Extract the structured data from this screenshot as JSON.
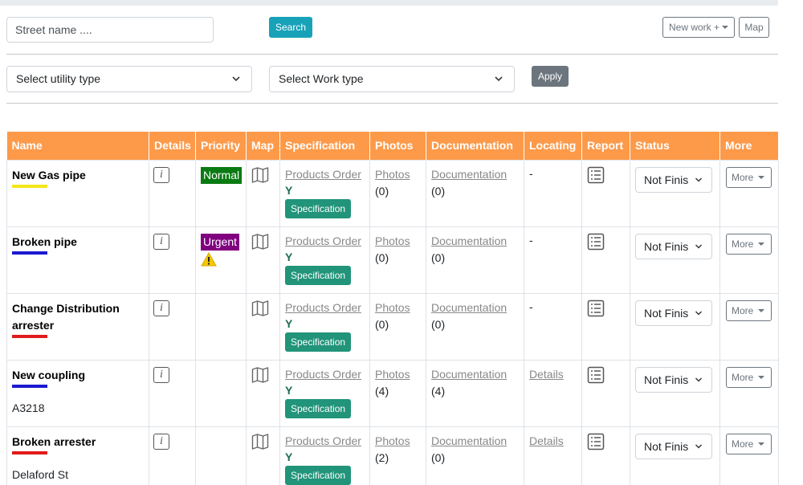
{
  "search": {
    "placeholder": "Street name ....",
    "button": "Search"
  },
  "header_actions": {
    "new_work": "New work +",
    "map": "Map"
  },
  "filters": {
    "utility_type": "Select utility type",
    "work_type": "Select Work type",
    "apply": "Apply"
  },
  "table": {
    "columns": [
      "Name",
      "Details",
      "Priority",
      "Map",
      "Specification",
      "Photos",
      "Documentation",
      "Locating",
      "Report",
      "Status",
      "More"
    ],
    "rows": [
      {
        "name": "New Gas pipe",
        "name_color": "#f5e61a",
        "subtitle": "",
        "priority": "Normal",
        "priority_color": "#0a7a12",
        "priority_warning": false,
        "spec_link": "Products Order",
        "spec_flag": "Y",
        "spec_button": "Specification",
        "photos_link": "Photos",
        "photos_count": "(0)",
        "docs_link": "Documentation",
        "docs_count": "(0)",
        "locating": "-",
        "locating_is_link": false,
        "status": "Not Finis",
        "more": "More"
      },
      {
        "name": "Broken pipe",
        "name_color": "#1a1ad0",
        "subtitle": "",
        "priority": "Urgent",
        "priority_color": "#800080",
        "priority_warning": true,
        "spec_link": "Products Order",
        "spec_flag": "Y",
        "spec_button": "Specification",
        "photos_link": "Photos",
        "photos_count": "(0)",
        "docs_link": "Documentation",
        "docs_count": "(0)",
        "locating": "-",
        "locating_is_link": false,
        "status": "Not Finis",
        "more": "More"
      },
      {
        "name": "Change Distribution arrester",
        "name_color": "#e01b1b",
        "subtitle": "",
        "priority": "",
        "priority_color": "",
        "priority_warning": false,
        "spec_link": "Products Order",
        "spec_flag": "Y",
        "spec_button": "Specification",
        "photos_link": "Photos",
        "photos_count": "(0)",
        "docs_link": "Documentation",
        "docs_count": "(0)",
        "locating": "-",
        "locating_is_link": false,
        "status": "Not Finis",
        "more": "More"
      },
      {
        "name": "New coupling",
        "name_color": "#1a1ad0",
        "subtitle": "A3218",
        "priority": "",
        "priority_color": "",
        "priority_warning": false,
        "spec_link": "Products Order",
        "spec_flag": "Y",
        "spec_button": "Specification",
        "photos_link": "Photos",
        "photos_count": "(4)",
        "docs_link": "Documentation",
        "docs_count": "(4)",
        "locating": "Details",
        "locating_is_link": true,
        "status": "Not Finis",
        "more": "More"
      },
      {
        "name": "Broken arrester",
        "name_color": "#e01b1b",
        "subtitle": "Delaford St",
        "priority": "",
        "priority_color": "",
        "priority_warning": false,
        "spec_link": "Products Order",
        "spec_flag": "Y",
        "spec_button": "Specification",
        "photos_link": "Photos",
        "photos_count": "(2)",
        "docs_link": "Documentation",
        "docs_count": "(0)",
        "locating": "Details",
        "locating_is_link": true,
        "status": "Not Finis",
        "more": "More"
      }
    ]
  },
  "icons": {
    "details": "info-icon",
    "map": "map-icon",
    "report": "report-icon",
    "warning": "warning-icon",
    "dropdown": "chevron-down-icon"
  },
  "colors": {
    "header": "#fd9a4a",
    "search_button": "#17a2b8",
    "spec_button": "#21947a",
    "apply_button": "#6c757d"
  }
}
